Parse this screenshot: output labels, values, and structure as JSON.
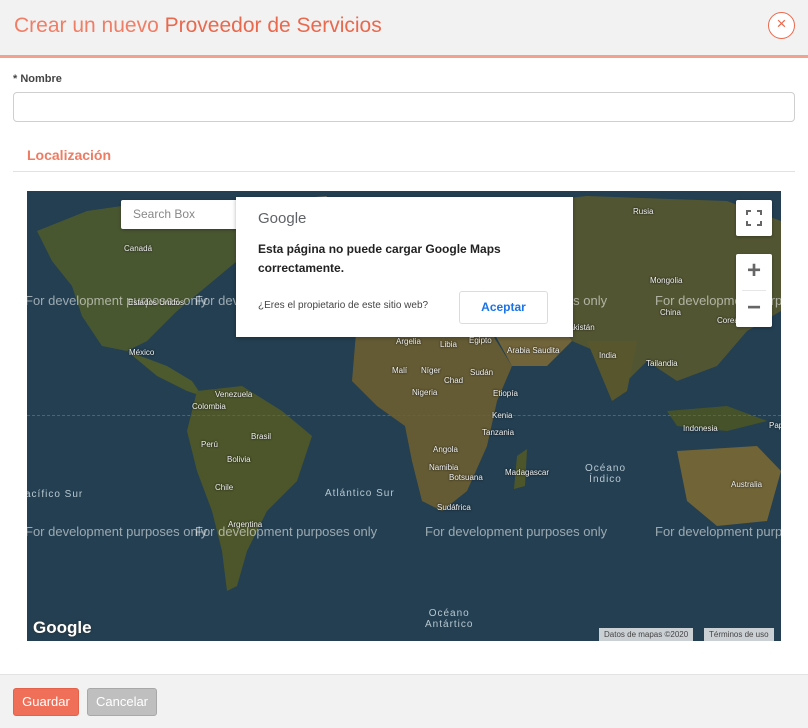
{
  "header": {
    "title_prefix": "Crear un nuevo",
    "title_main": "Proveedor de Servicios",
    "close_icon": "×"
  },
  "form": {
    "name_required_mark": "*",
    "name_label": "Nombre",
    "name_value": "",
    "section_title": "Localización"
  },
  "map": {
    "search_placeholder": "Search Box",
    "watermark": "For development purposes only",
    "logo": "Google",
    "attribution_data": "Datos de mapas ©2020",
    "attribution_terms": "Términos de uso",
    "zoom_in": "+",
    "zoom_out": "−",
    "places": {
      "canada": "Canadá",
      "usa": "Estados Unidos",
      "mexico": "México",
      "venezuela": "Venezuela",
      "colombia": "Colombia",
      "peru": "Perú",
      "brasil": "Brasil",
      "bolivia": "Bolivia",
      "chile": "Chile",
      "argentina": "Argentina",
      "argelia": "Argelia",
      "libia": "Libia",
      "egipto": "Egipto",
      "mali": "Malí",
      "niger": "Níger",
      "chad": "Chad",
      "sudan": "Sudán",
      "nigeria": "Nigeria",
      "etiopia": "Etiopía",
      "kenia": "Kenia",
      "tanzania": "Tanzania",
      "angola": "Angola",
      "namibia": "Namibia",
      "botsuana": "Botsuana",
      "sudafrica": "Sudáfrica",
      "madagascar": "Madagascar",
      "arabia": "Arabia Saudita",
      "pakistan": "Pakistán",
      "india": "India",
      "tailandia": "Tailandia",
      "indonesia": "Indonesia",
      "australia": "Australia",
      "rusia": "Rusia",
      "mongolia": "Mongolia",
      "china": "China",
      "corea": "Corea del Sur",
      "png": "Papúa Nueva Guinea"
    },
    "oceans": {
      "pacifico_sur": "acífico Sur",
      "atlantico_sur": "Atlántico Sur",
      "indico_line1": "Océano",
      "indico_line2": "Índico",
      "antartico_line1": "Océano",
      "antartico_line2": "Antártico"
    }
  },
  "error_dialog": {
    "logo": "Google",
    "message": "Esta página no puede cargar Google Maps correctamente.",
    "owner_question": "¿Eres el propietario de este sitio web?",
    "accept_label": "Aceptar"
  },
  "footer": {
    "save_label": "Guardar",
    "cancel_label": "Cancelar"
  }
}
